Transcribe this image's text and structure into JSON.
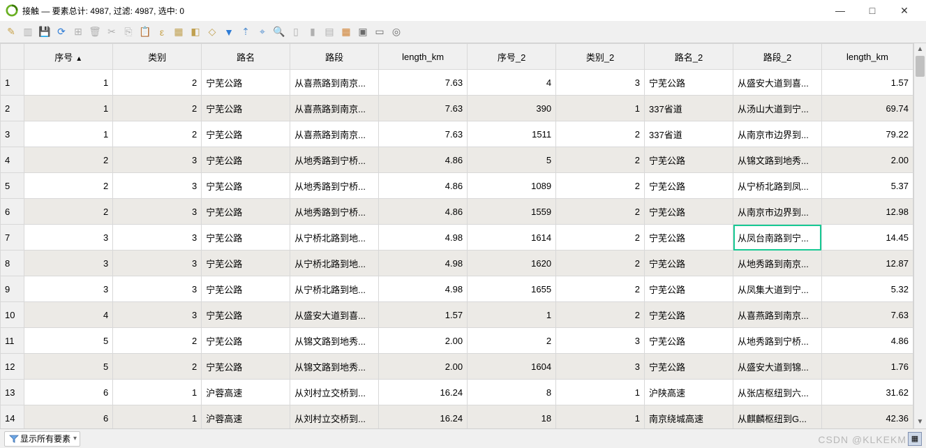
{
  "window": {
    "title": "接触 — 要素总计: 4987, 过滤: 4987, 选中: 0",
    "minimize": "—",
    "maximize": "□",
    "close": "✕"
  },
  "toolbar": {
    "icons": [
      {
        "name": "pencil-icon",
        "glyph": "✎",
        "color": "#c7a24a"
      },
      {
        "name": "toggle-edit-icon",
        "glyph": "▥",
        "color": "#b0b0b0"
      },
      {
        "name": "save-icon",
        "glyph": "💾",
        "color": "#b0b0b0"
      },
      {
        "name": "refresh-icon",
        "glyph": "⟳",
        "color": "#2e7cd6"
      },
      {
        "name": "add-feature-icon",
        "glyph": "⊞",
        "color": "#b0b0b0"
      },
      {
        "name": "delete-icon",
        "glyph": "🗑",
        "color": "#b0b0b0"
      },
      {
        "name": "cut-icon",
        "glyph": "✂",
        "color": "#b0b0b0"
      },
      {
        "name": "copy-icon",
        "glyph": "⎘",
        "color": "#b0b0b0"
      },
      {
        "name": "paste-icon",
        "glyph": "📋",
        "color": "#b0b0b0"
      },
      {
        "name": "expression-select-icon",
        "glyph": "ε",
        "color": "#c7a24a"
      },
      {
        "name": "select-all-icon",
        "glyph": "▦",
        "color": "#c0a050"
      },
      {
        "name": "invert-select-icon",
        "glyph": "◧",
        "color": "#c0a050"
      },
      {
        "name": "deselect-icon",
        "glyph": "◇",
        "color": "#c0a050"
      },
      {
        "name": "filter-select-icon",
        "glyph": "▼",
        "color": "#2e7cd6"
      },
      {
        "name": "move-top-icon",
        "glyph": "⇡",
        "color": "#5590d0"
      },
      {
        "name": "pan-to-icon",
        "glyph": "⌖",
        "color": "#5590d0"
      },
      {
        "name": "zoom-to-icon",
        "glyph": "🔍",
        "color": "#7aa8d8"
      },
      {
        "name": "new-column-icon",
        "glyph": "▯",
        "color": "#b0b0b0"
      },
      {
        "name": "delete-column-icon",
        "glyph": "▮",
        "color": "#b0b0b0"
      },
      {
        "name": "calculator-icon",
        "glyph": "▤",
        "color": "#b0b0b0"
      },
      {
        "name": "conditional-format-icon",
        "glyph": "▦",
        "color": "#d08030"
      },
      {
        "name": "form-view-icon",
        "glyph": "▣",
        "color": "#6a6a6a"
      },
      {
        "name": "dock-icon",
        "glyph": "▭",
        "color": "#6a6a6a"
      },
      {
        "name": "actions-icon",
        "glyph": "◎",
        "color": "#6a6a6a"
      }
    ]
  },
  "columns": {
    "xh": "序号",
    "lb": "类别",
    "lm": "路名",
    "ld": "路段",
    "len": "length_km",
    "xh2": "序号_2",
    "lb2": "类别_2",
    "lm2": "路名_2",
    "ld2": "路段_2",
    "len2": "length_km",
    "sort_arrow": "▲"
  },
  "rows": [
    {
      "n": "1",
      "xh": "1",
      "lb": "2",
      "lm": "宁芜公路",
      "ld": "从喜燕路到南京...",
      "len": "7.63",
      "xh2": "4",
      "lb2": "3",
      "lm2": "宁芜公路",
      "ld2": "从盛安大道到喜...",
      "len2": "1.57"
    },
    {
      "n": "2",
      "xh": "1",
      "lb": "2",
      "lm": "宁芜公路",
      "ld": "从喜燕路到南京...",
      "len": "7.63",
      "xh2": "390",
      "lb2": "1",
      "lm2": "337省道",
      "ld2": "从汤山大道到宁...",
      "len2": "69.74"
    },
    {
      "n": "3",
      "xh": "1",
      "lb": "2",
      "lm": "宁芜公路",
      "ld": "从喜燕路到南京...",
      "len": "7.63",
      "xh2": "1511",
      "lb2": "2",
      "lm2": "337省道",
      "ld2": "从南京市边界到...",
      "len2": "79.22"
    },
    {
      "n": "4",
      "xh": "2",
      "lb": "3",
      "lm": "宁芜公路",
      "ld": "从地秀路到宁桥...",
      "len": "4.86",
      "xh2": "5",
      "lb2": "2",
      "lm2": "宁芜公路",
      "ld2": "从锦文路到地秀...",
      "len2": "2.00"
    },
    {
      "n": "5",
      "xh": "2",
      "lb": "3",
      "lm": "宁芜公路",
      "ld": "从地秀路到宁桥...",
      "len": "4.86",
      "xh2": "1089",
      "lb2": "2",
      "lm2": "宁芜公路",
      "ld2": "从宁桥北路到凤...",
      "len2": "5.37"
    },
    {
      "n": "6",
      "xh": "2",
      "lb": "3",
      "lm": "宁芜公路",
      "ld": "从地秀路到宁桥...",
      "len": "4.86",
      "xh2": "1559",
      "lb2": "2",
      "lm2": "宁芜公路",
      "ld2": "从南京市边界到...",
      "len2": "12.98"
    },
    {
      "n": "7",
      "xh": "3",
      "lb": "3",
      "lm": "宁芜公路",
      "ld": "从宁桥北路到地...",
      "len": "4.98",
      "xh2": "1614",
      "lb2": "2",
      "lm2": "宁芜公路",
      "ld2": "从凤台南路到宁...",
      "len2": "14.45",
      "hl": true
    },
    {
      "n": "8",
      "xh": "3",
      "lb": "3",
      "lm": "宁芜公路",
      "ld": "从宁桥北路到地...",
      "len": "4.98",
      "xh2": "1620",
      "lb2": "2",
      "lm2": "宁芜公路",
      "ld2": "从地秀路到南京...",
      "len2": "12.87"
    },
    {
      "n": "9",
      "xh": "3",
      "lb": "3",
      "lm": "宁芜公路",
      "ld": "从宁桥北路到地...",
      "len": "4.98",
      "xh2": "1655",
      "lb2": "2",
      "lm2": "宁芜公路",
      "ld2": "从凤集大道到宁...",
      "len2": "5.32"
    },
    {
      "n": "10",
      "xh": "4",
      "lb": "3",
      "lm": "宁芜公路",
      "ld": "从盛安大道到喜...",
      "len": "1.57",
      "xh2": "1",
      "lb2": "2",
      "lm2": "宁芜公路",
      "ld2": "从喜燕路到南京...",
      "len2": "7.63"
    },
    {
      "n": "11",
      "xh": "5",
      "lb": "2",
      "lm": "宁芜公路",
      "ld": "从锦文路到地秀...",
      "len": "2.00",
      "xh2": "2",
      "lb2": "3",
      "lm2": "宁芜公路",
      "ld2": "从地秀路到宁桥...",
      "len2": "4.86"
    },
    {
      "n": "12",
      "xh": "5",
      "lb": "2",
      "lm": "宁芜公路",
      "ld": "从锦文路到地秀...",
      "len": "2.00",
      "xh2": "1604",
      "lb2": "3",
      "lm2": "宁芜公路",
      "ld2": "从盛安大道到锦...",
      "len2": "1.76"
    },
    {
      "n": "13",
      "xh": "6",
      "lb": "1",
      "lm": "沪蓉高速",
      "ld": "从刘村立交桥到...",
      "len": "16.24",
      "xh2": "8",
      "lb2": "1",
      "lm2": "沪陕高速",
      "ld2": "从张店枢纽到六...",
      "len2": "31.62"
    },
    {
      "n": "14",
      "xh": "6",
      "lb": "1",
      "lm": "沪蓉高速",
      "ld": "从刘村立交桥到...",
      "len": "16.24",
      "xh2": "18",
      "lb2": "1",
      "lm2": "南京绕城高速",
      "ld2": "从麒麟枢纽到G...",
      "len2": "42.36"
    }
  ],
  "footer": {
    "show_all": "显示所有要素",
    "dropdown_arrow": "▾"
  },
  "watermark": "CSDN @KLKEKM"
}
